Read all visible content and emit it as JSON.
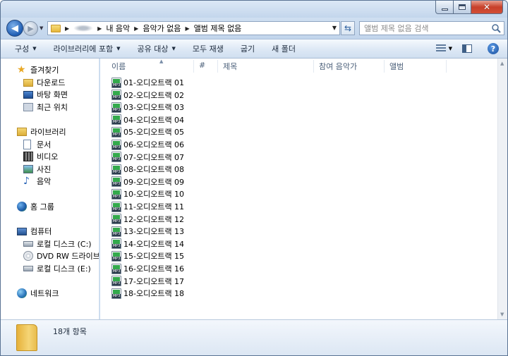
{
  "titlebar": {
    "minimize_icon": "minimize-icon",
    "maximize_icon": "maximize-icon",
    "close_icon": "close-icon"
  },
  "address": {
    "crumbs": [
      "내 음악",
      "음악가 없음",
      "앨범 제목 없음"
    ],
    "search_placeholder": "앨범 제목 없음 검색"
  },
  "toolbar": {
    "organize": "구성",
    "include_library": "라이브러리에 포함",
    "share": "공유 대상",
    "play_all": "모두 재생",
    "burn": "굽기",
    "new_folder": "새 폴더"
  },
  "nav": {
    "favorites": "즐겨찾기",
    "downloads": "다운로드",
    "desktop": "바탕 화면",
    "recent": "최근 위치",
    "libraries": "라이브러리",
    "documents": "문서",
    "videos": "비디오",
    "pictures": "사진",
    "music": "음악",
    "homegroup": "홈 그룹",
    "computer": "컴퓨터",
    "local_disk_c": "로컬 디스크 (C:)",
    "dvd_drive": "DVD RW 드라이브 (",
    "local_disk_e": "로컬 디스크 (E:)",
    "network": "네트워크"
  },
  "columns": {
    "name": "이름",
    "number": "#",
    "title": "제목",
    "artists": "참여 음악가",
    "album": "앨범"
  },
  "files": [
    "01-오디오트랙 01",
    "02-오디오트랙 02",
    "03-오디오트랙 03",
    "04-오디오트랙 04",
    "05-오디오트랙 05",
    "06-오디오트랙 06",
    "07-오디오트랙 07",
    "08-오디오트랙 08",
    "09-오디오트랙 09",
    "10-오디오트랙 10",
    "11-오디오트랙 11",
    "12-오디오트랙 12",
    "13-오디오트랙 13",
    "14-오디오트랙 14",
    "15-오디오트랙 15",
    "16-오디오트랙 16",
    "17-오디오트랙 17",
    "18-오디오트랙 18"
  ],
  "details": {
    "item_count": "18개 항목"
  },
  "colors": {
    "frame": "#c5d8ee",
    "accent": "#1f5db3"
  }
}
